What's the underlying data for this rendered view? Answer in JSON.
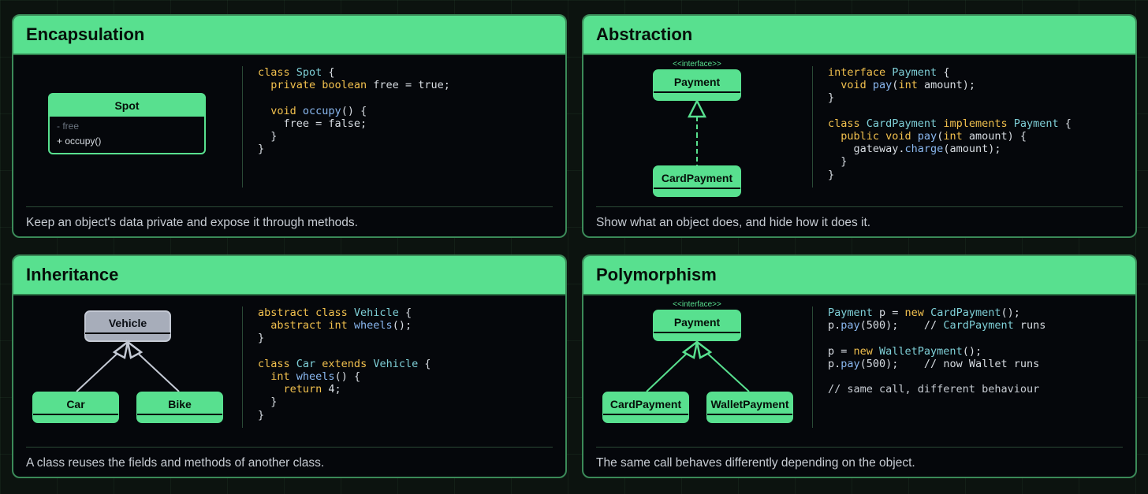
{
  "colors": {
    "accent": "#58e08f",
    "background": "#05070b",
    "keyword": "#f2c14e",
    "type": "#7fd0d8",
    "function": "#8ab8f0"
  },
  "cards": [
    {
      "title": "Encapsulation",
      "description": "Keep an object's data private and expose it through methods.",
      "diagram": {
        "class_name": "Spot",
        "field": "- free",
        "method": "+ occupy()"
      },
      "code": [
        [
          {
            "t": "class ",
            "c": "kw"
          },
          {
            "t": "Spot",
            "c": "ty"
          },
          {
            "t": " {",
            "c": ""
          }
        ],
        [
          {
            "t": "  private boolean",
            "c": "kw"
          },
          {
            "t": " free = true;",
            "c": ""
          }
        ],
        [],
        [
          {
            "t": "  void ",
            "c": "kw"
          },
          {
            "t": "occupy",
            "c": "fn"
          },
          {
            "t": "() {",
            "c": ""
          }
        ],
        [
          {
            "t": "    free = false;",
            "c": ""
          }
        ],
        [
          {
            "t": "  }",
            "c": ""
          }
        ],
        [
          {
            "t": "}",
            "c": ""
          }
        ]
      ]
    },
    {
      "title": "Abstraction",
      "description": "Show what an object does, and hide how it does it.",
      "diagram": {
        "stereotype": "<<interface>>",
        "interface": "Payment",
        "implementation": "CardPayment"
      },
      "code": [
        [
          {
            "t": "interface ",
            "c": "kw"
          },
          {
            "t": "Payment",
            "c": "ty"
          },
          {
            "t": " {",
            "c": ""
          }
        ],
        [
          {
            "t": "  void ",
            "c": "kw"
          },
          {
            "t": "pay",
            "c": "fn"
          },
          {
            "t": "(",
            "c": ""
          },
          {
            "t": "int",
            "c": "kw"
          },
          {
            "t": " amount);",
            "c": ""
          }
        ],
        [
          {
            "t": "}",
            "c": ""
          }
        ],
        [],
        [
          {
            "t": "class ",
            "c": "kw"
          },
          {
            "t": "CardPayment ",
            "c": "ty"
          },
          {
            "t": "implements ",
            "c": "kw"
          },
          {
            "t": "Payment",
            "c": "ty"
          },
          {
            "t": " {",
            "c": ""
          }
        ],
        [
          {
            "t": "  public void ",
            "c": "kw"
          },
          {
            "t": "pay",
            "c": "fn"
          },
          {
            "t": "(",
            "c": ""
          },
          {
            "t": "int",
            "c": "kw"
          },
          {
            "t": " amount) {",
            "c": ""
          }
        ],
        [
          {
            "t": "    gateway.",
            "c": ""
          },
          {
            "t": "charge",
            "c": "fn"
          },
          {
            "t": "(amount);",
            "c": ""
          }
        ],
        [
          {
            "t": "  }",
            "c": ""
          }
        ],
        [
          {
            "t": "}",
            "c": ""
          }
        ]
      ]
    },
    {
      "title": "Inheritance",
      "description": "A class reuses the fields and methods of another class.",
      "diagram": {
        "parent": "Vehicle",
        "child_left": "Car",
        "child_right": "Bike"
      },
      "code": [
        [
          {
            "t": "abstract class ",
            "c": "kw"
          },
          {
            "t": "Vehicle",
            "c": "ty"
          },
          {
            "t": " {",
            "c": ""
          }
        ],
        [
          {
            "t": "  abstract int ",
            "c": "kw"
          },
          {
            "t": "wheels",
            "c": "fn"
          },
          {
            "t": "();",
            "c": ""
          }
        ],
        [
          {
            "t": "}",
            "c": ""
          }
        ],
        [],
        [
          {
            "t": "class ",
            "c": "kw"
          },
          {
            "t": "Car ",
            "c": "ty"
          },
          {
            "t": "extends ",
            "c": "kw"
          },
          {
            "t": "Vehicle",
            "c": "ty"
          },
          {
            "t": " {",
            "c": ""
          }
        ],
        [
          {
            "t": "  int ",
            "c": "kw"
          },
          {
            "t": "wheels",
            "c": "fn"
          },
          {
            "t": "() {",
            "c": ""
          }
        ],
        [
          {
            "t": "    return ",
            "c": "kw"
          },
          {
            "t": "4;",
            "c": ""
          }
        ],
        [
          {
            "t": "  }",
            "c": ""
          }
        ],
        [
          {
            "t": "}",
            "c": ""
          }
        ]
      ]
    },
    {
      "title": "Polymorphism",
      "description": "The same call behaves differently depending on the object.",
      "diagram": {
        "stereotype": "<<interface>>",
        "interface": "Payment",
        "child_left": "CardPayment",
        "child_right": "WalletPayment"
      },
      "code": [
        [
          {
            "t": "Payment",
            "c": "ty"
          },
          {
            "t": " p = ",
            "c": ""
          },
          {
            "t": "new ",
            "c": "kw"
          },
          {
            "t": "CardPayment",
            "c": "ty"
          },
          {
            "t": "();",
            "c": ""
          }
        ],
        [
          {
            "t": "p.",
            "c": ""
          },
          {
            "t": "pay",
            "c": "fn"
          },
          {
            "t": "(500);    // ",
            "c": ""
          },
          {
            "t": "CardPayment",
            "c": "ty"
          },
          {
            "t": " runs",
            "c": ""
          }
        ],
        [],
        [
          {
            "t": "p = ",
            "c": ""
          },
          {
            "t": "new ",
            "c": "kw"
          },
          {
            "t": "WalletPayment",
            "c": "ty"
          },
          {
            "t": "();",
            "c": ""
          }
        ],
        [
          {
            "t": "p.",
            "c": ""
          },
          {
            "t": "pay",
            "c": "fn"
          },
          {
            "t": "(500);    // now Wallet runs",
            "c": ""
          }
        ],
        [],
        [
          {
            "t": "// same call, different behaviour",
            "c": "cm"
          }
        ]
      ]
    }
  ]
}
